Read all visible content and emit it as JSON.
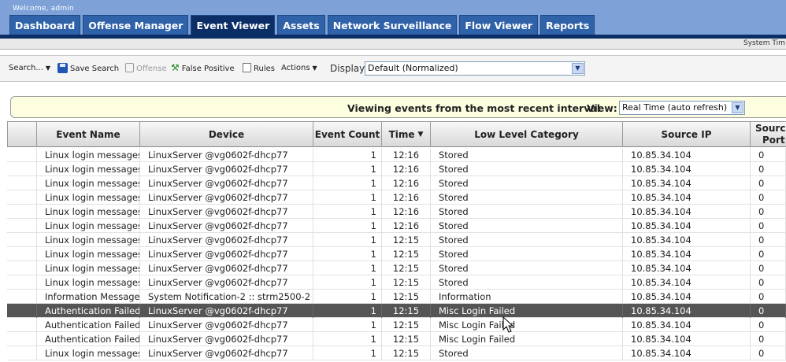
{
  "header": {
    "welcome": "Welcome, admin",
    "tabs": [
      {
        "label": "Dashboard",
        "active": false
      },
      {
        "label": "Offense Manager",
        "active": false
      },
      {
        "label": "Event Viewer",
        "active": true
      },
      {
        "label": "Assets",
        "active": false
      },
      {
        "label": "Network Surveillance",
        "active": false
      },
      {
        "label": "Flow Viewer",
        "active": false
      },
      {
        "label": "Reports",
        "active": false
      }
    ],
    "system_time_label": "System Tim"
  },
  "toolbar": {
    "search_label": "Search...",
    "save_search_label": "Save Search",
    "offense_label": "Offense",
    "false_positive_label": "False Positive",
    "rules_label": "Rules",
    "actions_label": "Actions",
    "display_label": "Display",
    "display_value": "Default (Normalized)"
  },
  "banner": {
    "text": "Viewing events from the most recent interval",
    "view_label": "View:",
    "view_value": "Real Time (auto refresh)"
  },
  "table": {
    "columns": [
      "Event Name",
      "Device",
      "Event Count",
      "Time",
      "Low Level Category",
      "Source IP",
      "Source Port"
    ],
    "rows": [
      {
        "event_name": "Linux login messages",
        "device": "LinuxServer @vg0602f-dhcp77",
        "count": "1",
        "time": "12:16",
        "category": "Stored",
        "source_ip": "10.85.34.104",
        "source_port": "0",
        "selected": false
      },
      {
        "event_name": "Linux login messages",
        "device": "LinuxServer @vg0602f-dhcp77",
        "count": "1",
        "time": "12:16",
        "category": "Stored",
        "source_ip": "10.85.34.104",
        "source_port": "0",
        "selected": false
      },
      {
        "event_name": "Linux login messages",
        "device": "LinuxServer @vg0602f-dhcp77",
        "count": "1",
        "time": "12:16",
        "category": "Stored",
        "source_ip": "10.85.34.104",
        "source_port": "0",
        "selected": false
      },
      {
        "event_name": "Linux login messages",
        "device": "LinuxServer @vg0602f-dhcp77",
        "count": "1",
        "time": "12:16",
        "category": "Stored",
        "source_ip": "10.85.34.104",
        "source_port": "0",
        "selected": false
      },
      {
        "event_name": "Linux login messages",
        "device": "LinuxServer @vg0602f-dhcp77",
        "count": "1",
        "time": "12:16",
        "category": "Stored",
        "source_ip": "10.85.34.104",
        "source_port": "0",
        "selected": false
      },
      {
        "event_name": "Linux login messages",
        "device": "LinuxServer @vg0602f-dhcp77",
        "count": "1",
        "time": "12:16",
        "category": "Stored",
        "source_ip": "10.85.34.104",
        "source_port": "0",
        "selected": false
      },
      {
        "event_name": "Linux login messages",
        "device": "LinuxServer @vg0602f-dhcp77",
        "count": "1",
        "time": "12:15",
        "category": "Stored",
        "source_ip": "10.85.34.104",
        "source_port": "0",
        "selected": false
      },
      {
        "event_name": "Linux login messages",
        "device": "LinuxServer @vg0602f-dhcp77",
        "count": "1",
        "time": "12:15",
        "category": "Stored",
        "source_ip": "10.85.34.104",
        "source_port": "0",
        "selected": false
      },
      {
        "event_name": "Linux login messages",
        "device": "LinuxServer @vg0602f-dhcp77",
        "count": "1",
        "time": "12:15",
        "category": "Stored",
        "source_ip": "10.85.34.104",
        "source_port": "0",
        "selected": false
      },
      {
        "event_name": "Linux login messages",
        "device": "LinuxServer @vg0602f-dhcp77",
        "count": "1",
        "time": "12:15",
        "category": "Stored",
        "source_ip": "10.85.34.104",
        "source_port": "0",
        "selected": false
      },
      {
        "event_name": "Information Message",
        "device": "System Notification-2 :: strm2500-2",
        "count": "1",
        "time": "12:15",
        "category": "Information",
        "source_ip": "10.85.34.104",
        "source_port": "0",
        "selected": false
      },
      {
        "event_name": "Authentication Failed",
        "device": "LinuxServer @vg0602f-dhcp77",
        "count": "1",
        "time": "12:15",
        "category": "Misc Login Failed",
        "source_ip": "10.85.34.104",
        "source_port": "0",
        "selected": true
      },
      {
        "event_name": "Authentication Failed",
        "device": "LinuxServer @vg0602f-dhcp77",
        "count": "1",
        "time": "12:15",
        "category": "Misc Login Failed",
        "source_ip": "10.85.34.104",
        "source_port": "0",
        "selected": false
      },
      {
        "event_name": "Authentication Failed",
        "device": "LinuxServer @vg0602f-dhcp77",
        "count": "1",
        "time": "12:15",
        "category": "Misc Login Failed",
        "source_ip": "10.85.34.104",
        "source_port": "0",
        "selected": false
      },
      {
        "event_name": "Linux login messages",
        "device": "LinuxServer @vg0602f-dhcp77",
        "count": "1",
        "time": "12:15",
        "category": "Stored",
        "source_ip": "10.85.34.104",
        "source_port": "0",
        "selected": false
      }
    ]
  },
  "colors": {
    "top_bar": "#7ea2d8",
    "tab": "#2f62a8",
    "tab_active": "#0b2e66",
    "banner_bg": "#fdfde0",
    "selected_row": "#555555"
  },
  "icons": {
    "save": "save-disk-icon",
    "offense": "offense-icon",
    "false_positive": "wrench-icon",
    "rules": "rules-document-icon",
    "dropdown": "chevron-down-icon",
    "sort": "sort-descending-icon",
    "cursor": "mouse-pointer-icon"
  }
}
